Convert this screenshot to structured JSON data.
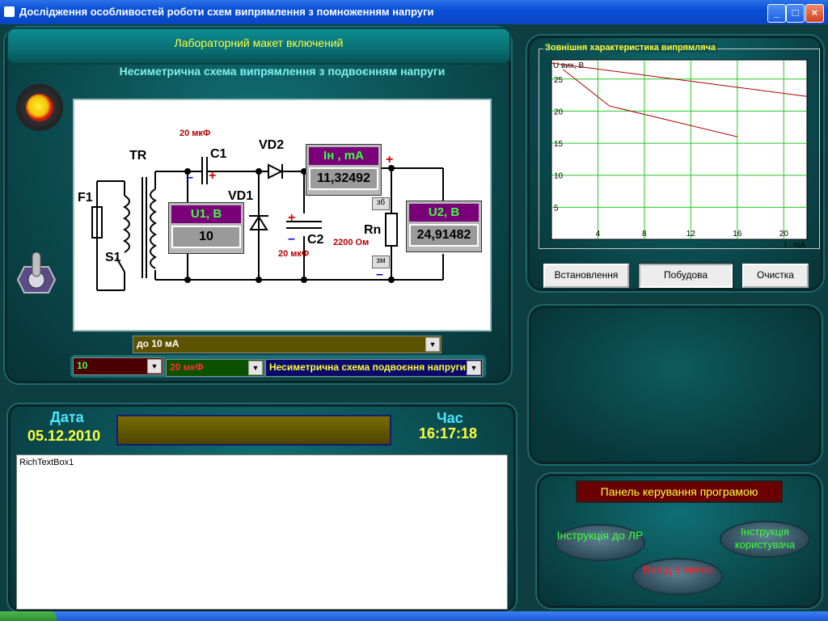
{
  "window": {
    "title": "Дослідження особливостей роботи схем випрямлення з помноженням напруги"
  },
  "header": {
    "status": "Лабораторний макет включений"
  },
  "schematic": {
    "title": "Несиметрична схема випрямлення з подвоєнням напруги",
    "labels": {
      "tr": "TR",
      "f1": "F1",
      "s1": "S1",
      "c1": "C1",
      "c2": "C2",
      "vd1": "VD1",
      "vd2": "VD2",
      "rn": "Rn",
      "c1_value": "20 мкФ",
      "c2_value": "20 мкФ",
      "rn_value": "2200 Ом",
      "zb": "зб",
      "zm": "зм"
    },
    "meters": {
      "u1": {
        "label": "U1, В",
        "value": "10"
      },
      "ih": {
        "label": "Iн , mA",
        "value": "11,32492"
      },
      "u2": {
        "label": "U2, В",
        "value": "24,91482"
      }
    }
  },
  "controls": {
    "current_select": "до 10 мА",
    "voltage_select": "10",
    "capacitance_select": "20 мкФ",
    "scheme_select": "Несиметрична схема подвоєння напруги"
  },
  "chart_panel": {
    "title": "Зовнішня характеристика випрямляча",
    "buttons": {
      "setup": "Встановлення",
      "build": "Побудова",
      "clear": "Очистка"
    }
  },
  "chart_data": {
    "type": "line",
    "ylabel": "U вих, В",
    "xlabel": "I , mA",
    "xlim": [
      0,
      22
    ],
    "ylim": [
      0,
      28
    ],
    "xticks": [
      4,
      8,
      12,
      16,
      20
    ],
    "yticks": [
      5,
      10,
      15,
      20,
      25
    ],
    "grid": true,
    "series": [
      {
        "x": [
          0,
          22
        ],
        "y": [
          27.5,
          22.3
        ]
      },
      {
        "x": [
          1,
          5,
          16
        ],
        "y": [
          26.5,
          20.8,
          16
        ]
      }
    ]
  },
  "datetime": {
    "date_label": "Дата",
    "date_value": "05.12.2010",
    "time_label": "Час",
    "time_value": "16:17:18"
  },
  "richtext": {
    "content": "RichTextBox1"
  },
  "program_panel": {
    "title": "Панель керування програмою",
    "lab_instructions": "Інструкція до ЛР",
    "user_instructions": "Інструкція користувача",
    "exit": "Вихід в меню"
  },
  "colors": {
    "meter_label_bg": "#7a007a",
    "meter_label_text": "#3dff3d",
    "led_red": "#d41b14",
    "accent_yellow": "#ffff3c"
  }
}
